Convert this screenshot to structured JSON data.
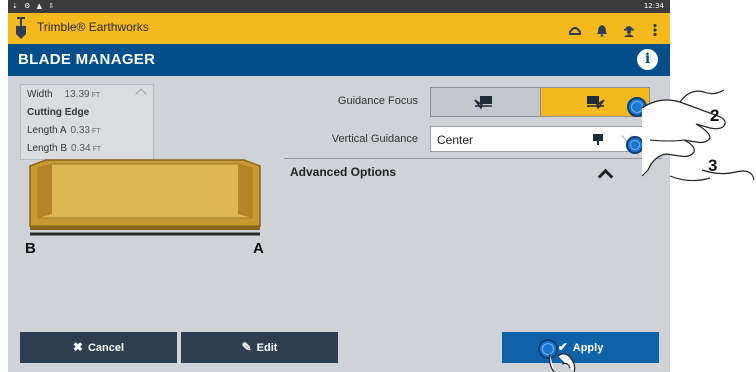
{
  "statusbar": {
    "time": "12:34"
  },
  "appbar": {
    "title": "Trimble® Earthworks",
    "icons": [
      "connection-icon",
      "bell-icon",
      "operator-icon",
      "more-vert-icon"
    ]
  },
  "page": {
    "title": "BLADE MANAGER"
  },
  "blade_info": {
    "width_label": "Width",
    "width_value": "13.39",
    "width_unit": "FT",
    "section_label": "Cutting Edge",
    "length_a_label": "Length A",
    "length_a_value": "0.33",
    "length_a_unit": "FT",
    "length_b_label": "Length B",
    "length_b_value": "0.34",
    "length_b_unit": "FT"
  },
  "blade_diagram": {
    "left_label": "B",
    "right_label": "A"
  },
  "form": {
    "guidance_focus_label": "Guidance Focus",
    "guidance_focus_selected": "right",
    "vertical_guidance_label": "Vertical Guidance",
    "vertical_guidance_value": "Center",
    "advanced_options_label": "Advanced Options"
  },
  "buttons": {
    "cancel": "Cancel",
    "edit": "Edit",
    "apply": "Apply"
  },
  "callouts": {
    "step_2": "2",
    "step_3": "3"
  },
  "colors": {
    "appbar": "#f6b91d",
    "titlebar": "#004f8c",
    "apply": "#0f62a8",
    "dark_button": "#2f3d51",
    "touch": "#1976d2"
  }
}
